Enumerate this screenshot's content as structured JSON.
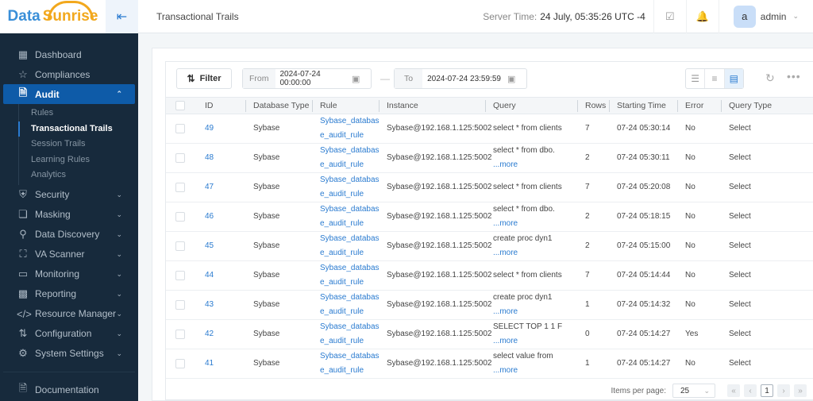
{
  "brand": {
    "part1": "Data",
    "part2": "Sunrise"
  },
  "header": {
    "title": "Transactional Trails",
    "server_time_label": "Server Time:",
    "server_time_value": "24 July, 05:35:26  UTC -4",
    "user_initial": "a",
    "user_name": "admin"
  },
  "sidebar": {
    "items": [
      {
        "label": "Dashboard",
        "icon": "grid-icon"
      },
      {
        "label": "Compliances",
        "icon": "star-icon"
      },
      {
        "label": "Audit",
        "icon": "document-icon"
      },
      {
        "label": "Security",
        "icon": "shield-icon"
      },
      {
        "label": "Masking",
        "icon": "masking-icon"
      },
      {
        "label": "Data Discovery",
        "icon": "search-icon"
      },
      {
        "label": "VA Scanner",
        "icon": "scanner-icon"
      },
      {
        "label": "Monitoring",
        "icon": "monitor-icon"
      },
      {
        "label": "Reporting",
        "icon": "bar-chart-icon"
      },
      {
        "label": "Resource Manager",
        "icon": "code-icon"
      },
      {
        "label": "Configuration",
        "icon": "sliders-icon"
      },
      {
        "label": "System Settings",
        "icon": "gear-icon"
      }
    ],
    "audit_sub": [
      "Rules",
      "Transactional Trails",
      "Session Trails",
      "Learning Rules",
      "Analytics"
    ],
    "documentation": "Documentation"
  },
  "toolbar": {
    "filter_label": "Filter",
    "from_label": "From",
    "from_value": "2024-07-24 00:00:00",
    "to_label": "To",
    "to_value": "2024-07-24 23:59:59"
  },
  "table": {
    "columns": [
      "ID",
      "Database Type",
      "Rule",
      "Instance",
      "Query",
      "Rows",
      "Starting Time",
      "Error",
      "Query Type"
    ],
    "more_label": "...more",
    "rows": [
      {
        "id": "49",
        "db": "Sybase",
        "rule1": "Sybase_databas",
        "rule2": "e_audit_rule",
        "instance": "Sybase@192.168.1.125:5002",
        "query": "select * from clients",
        "more": false,
        "rows": "7",
        "time": "07-24 05:30:14",
        "error": "No",
        "qtype": "Select"
      },
      {
        "id": "48",
        "db": "Sybase",
        "rule1": "Sybase_databas",
        "rule2": "e_audit_rule",
        "instance": "Sybase@192.168.1.125:5002",
        "query": "select * from dbo.",
        "more": true,
        "rows": "2",
        "time": "07-24 05:30:11",
        "error": "No",
        "qtype": "Select"
      },
      {
        "id": "47",
        "db": "Sybase",
        "rule1": "Sybase_databas",
        "rule2": "e_audit_rule",
        "instance": "Sybase@192.168.1.125:5002",
        "query": "select * from clients",
        "more": false,
        "rows": "7",
        "time": "07-24 05:20:08",
        "error": "No",
        "qtype": "Select"
      },
      {
        "id": "46",
        "db": "Sybase",
        "rule1": "Sybase_databas",
        "rule2": "e_audit_rule",
        "instance": "Sybase@192.168.1.125:5002",
        "query": "select * from dbo.",
        "more": true,
        "rows": "2",
        "time": "07-24 05:18:15",
        "error": "No",
        "qtype": "Select"
      },
      {
        "id": "45",
        "db": "Sybase",
        "rule1": "Sybase_databas",
        "rule2": "e_audit_rule",
        "instance": "Sybase@192.168.1.125:5002",
        "query": "create proc dyn1",
        "more": true,
        "rows": "2",
        "time": "07-24 05:15:00",
        "error": "No",
        "qtype": "Select"
      },
      {
        "id": "44",
        "db": "Sybase",
        "rule1": "Sybase_databas",
        "rule2": "e_audit_rule",
        "instance": "Sybase@192.168.1.125:5002",
        "query": "select * from clients",
        "more": false,
        "rows": "7",
        "time": "07-24 05:14:44",
        "error": "No",
        "qtype": "Select"
      },
      {
        "id": "43",
        "db": "Sybase",
        "rule1": "Sybase_databas",
        "rule2": "e_audit_rule",
        "instance": "Sybase@192.168.1.125:5002",
        "query": "create proc dyn1",
        "more": true,
        "rows": "1",
        "time": "07-24 05:14:32",
        "error": "No",
        "qtype": "Select"
      },
      {
        "id": "42",
        "db": "Sybase",
        "rule1": "Sybase_databas",
        "rule2": "e_audit_rule",
        "instance": "Sybase@192.168.1.125:5002",
        "query": "SELECT TOP 1 1 F",
        "more": true,
        "rows": "0",
        "time": "07-24 05:14:27",
        "error": "Yes",
        "qtype": "Select"
      },
      {
        "id": "41",
        "db": "Sybase",
        "rule1": "Sybase_databas",
        "rule2": "e_audit_rule",
        "instance": "Sybase@192.168.1.125:5002",
        "query": "select value from",
        "more": true,
        "rows": "1",
        "time": "07-24 05:14:27",
        "error": "No",
        "qtype": "Select"
      }
    ]
  },
  "pager": {
    "items_per_page_label": "Items per page:",
    "items_per_page": "25",
    "current_page": "1"
  },
  "colors": {
    "accent": "#0e5ba8",
    "link": "#2a7bd0",
    "sidebar_bg": "#172a3c",
    "brand_orange": "#f2a81d"
  }
}
